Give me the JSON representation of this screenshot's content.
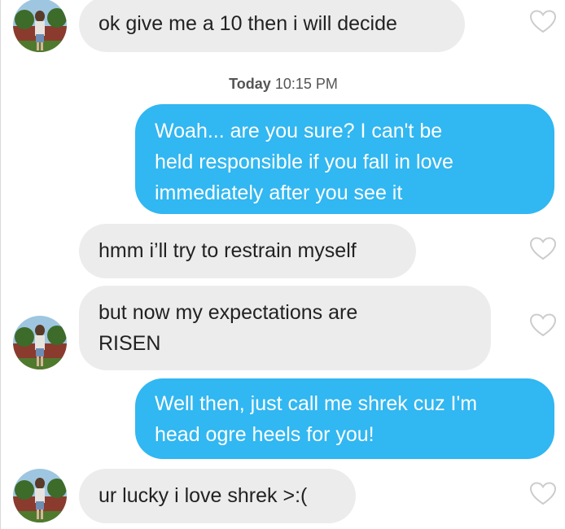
{
  "messages": [
    {
      "dir": "in",
      "lines": [
        "ok give me a 10 then i will decide"
      ]
    },
    {
      "dir": "out",
      "lines": [
        "Woah... are you sure? I can't be",
        "held responsible if you fall in love",
        "immediately after you see it"
      ]
    },
    {
      "dir": "in",
      "lines": [
        "hmm i’ll try to restrain myself"
      ]
    },
    {
      "dir": "in",
      "lines": [
        "but now my expectations are",
        "RISEN"
      ]
    },
    {
      "dir": "out",
      "lines": [
        "Well then, just call me shrek cuz I'm",
        "head ogre heels for you!"
      ]
    },
    {
      "dir": "in",
      "lines": [
        "ur lucky i love shrek >:("
      ]
    }
  ],
  "timestamp": {
    "day": "Today",
    "time": "10:15 PM"
  },
  "colors": {
    "incoming": "#ececec",
    "outgoing": "#31b7f1",
    "heart": "#cccccc"
  },
  "icons": {
    "like": "heart-outline-icon",
    "avatar": "profile-photo"
  }
}
